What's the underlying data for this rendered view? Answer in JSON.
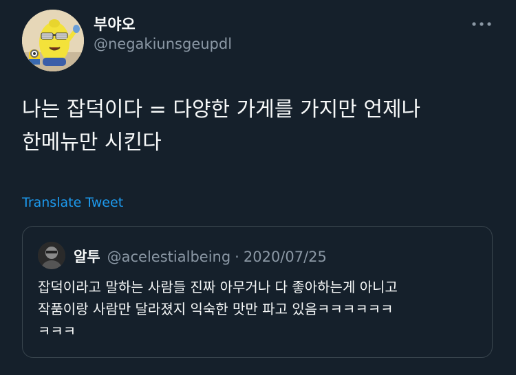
{
  "author": {
    "display_name": "부야오",
    "handle": "@negakiunsgeupdl",
    "avatar_icon": "cartoon-character-avatar"
  },
  "more_icon": "more-horizontal-icon",
  "tweet": {
    "text": "나는 잡덕이다 = 다양한 가게를 가지만 언제나\n한메뉴만 시킨다",
    "translate_label": "Translate Tweet"
  },
  "quoted": {
    "display_name": "알투",
    "handle": "@acelestialbeing",
    "separator": "·",
    "date": "2020/07/25",
    "text": "잡덕이라고 말하는 사람들 진짜 아무거나 다 좋아하는게 아니고\n작품이랑 사람만 달라졌지 익숙한 맛만 파고 있음ㅋㅋㅋㅋㅋㅋ\nㅋㅋㅋ"
  },
  "colors": {
    "background": "#15202b",
    "text_primary": "#f7f9f9",
    "text_secondary": "#8b98a5",
    "link": "#1d9bf0",
    "border": "#38444d"
  }
}
